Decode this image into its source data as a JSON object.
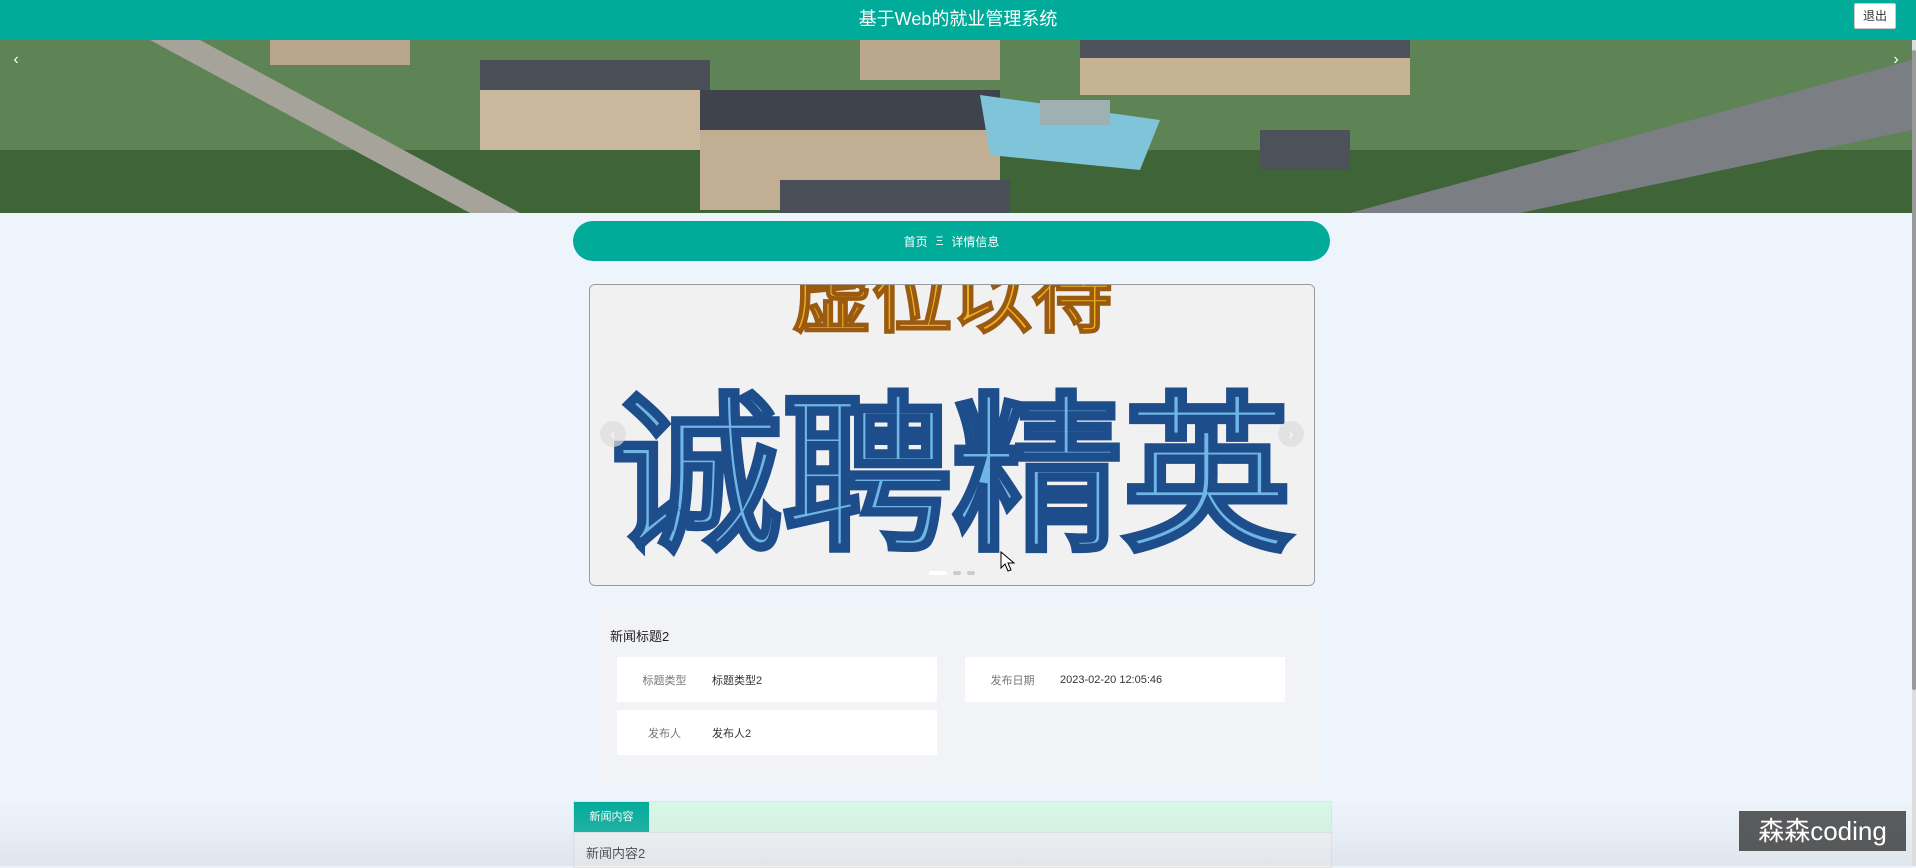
{
  "header": {
    "title": "基于Web的就业管理系统",
    "logout_label": "退出"
  },
  "banner": {
    "prev_icon": "chevron-left-icon",
    "next_icon": "chevron-right-icon"
  },
  "breadcrumb": {
    "home": "首页",
    "separator": "Ξ",
    "current": "详情信息"
  },
  "carousel": {
    "image_text_top": "虚位以待",
    "image_text_main": "诚聘精英",
    "slide_count": 3,
    "active_slide": 1
  },
  "news": {
    "title": "新闻标题2",
    "fields": [
      {
        "label": "标题类型",
        "value": "标题类型2"
      },
      {
        "label": "发布日期",
        "value": "2023-02-20 12:05:46"
      },
      {
        "label": "发布人",
        "value": "发布人2"
      }
    ],
    "content_tab": "新闻内容",
    "content": "新闻内容2"
  },
  "watermark": "森森coding",
  "colors": {
    "primary": "#00ab99",
    "page_bg": "#eef4fb",
    "tab_row_bg": "#d8f8e6"
  }
}
